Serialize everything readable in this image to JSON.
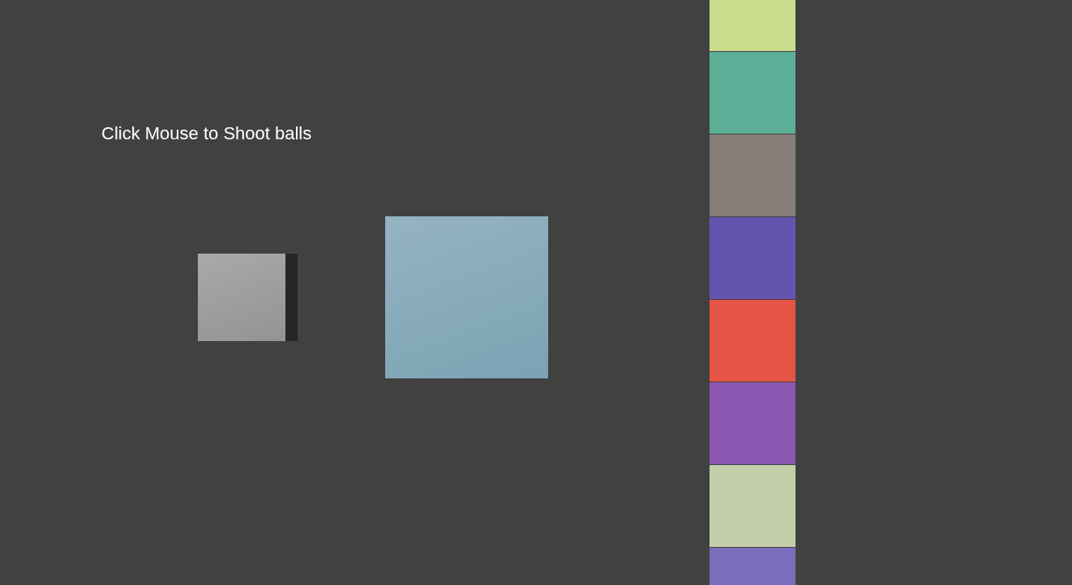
{
  "instruction": "Click Mouse to Shoot balls",
  "block_stack": [
    {
      "color": "#cbdc8f"
    },
    {
      "color": "#5dae96"
    },
    {
      "color": "#847d78"
    },
    {
      "color": "#6553b0"
    },
    {
      "color": "#e65446"
    },
    {
      "color": "#8b57b0"
    },
    {
      "color": "#c3cfa8"
    },
    {
      "color": "#7b6dbd"
    }
  ]
}
